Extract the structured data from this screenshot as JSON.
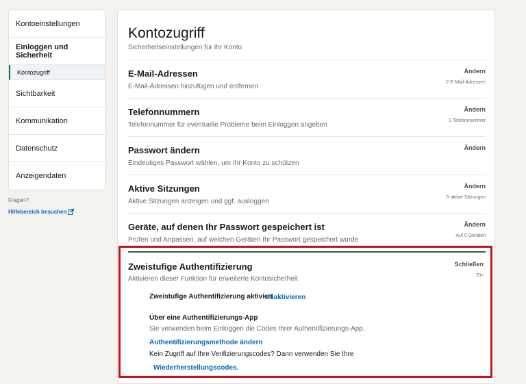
{
  "sidebar": {
    "items": [
      {
        "label": "Kontoeinstellungen"
      },
      {
        "label": "Einloggen und Sicherheit"
      },
      {
        "label": "Kontozugriff"
      },
      {
        "label": "Sichtbarkeit"
      },
      {
        "label": "Kommunikation"
      },
      {
        "label": "Datenschutz"
      },
      {
        "label": "Anzeigendaten"
      }
    ],
    "help_question": "Fragen?",
    "help_link": "Hilfebereich besuchen"
  },
  "main": {
    "title": "Kontozugriff",
    "subtitle": "Sicherheitseinstellungen für Ihr Konto",
    "sections": [
      {
        "title": "E-Mail-Adressen",
        "desc": "E-Mail-Adressen hinzufügen und entfernen",
        "action": "Ändern",
        "meta": "2 E-Mail-Adressen"
      },
      {
        "title": "Telefonnummern",
        "desc": "Telefonnummer für eventuelle Probleme beim Einloggen angeben",
        "action": "Ändern",
        "meta": "1 Telefonnummer"
      },
      {
        "title": "Passwort ändern",
        "desc": "Eindeutiges Passwort wählen, um Ihr Konto zu schützen",
        "action": "Ändern",
        "meta": ""
      },
      {
        "title": "Aktive Sitzungen",
        "desc": "Aktive Sitzungen anzeigen und ggf. ausloggen",
        "action": "Ändern",
        "meta": "5 aktive Sitzungen"
      },
      {
        "title": "Geräte, auf denen Ihr Passwort gespeichert ist",
        "desc": "Prüfen und Anpassen, auf welchen Geräten Ihr Passwort gespeichert wurde",
        "action": "Ändern",
        "meta": "Auf 0 Geräten"
      }
    ],
    "two_factor": {
      "title": "Zweistufige Authentifizierung",
      "desc": "Aktivieren dieser Funktion für erweiterte Kontosicherheit",
      "action": "Schließen",
      "state": "Ein",
      "status_text": "Zweistufige Authentifizierung aktiviert",
      "deactivate": "deaktivieren",
      "method_heading": "Über eine Authentifizierungs-App",
      "method_desc": "Sie verwenden beim Einloggen die Codes Ihrer Authentifizierungs-App.",
      "change_method": "Authentifizierungsmethode ändern",
      "no_access": "Kein Zugriff auf Ihre Verifizierungscodes? Dann verwenden Sie Ihre",
      "recovery_codes": "Wiederherstellungscodes."
    }
  },
  "colors": {
    "link": "#0a66c2",
    "highlight_border": "#c0141b",
    "active_marker": "#057642"
  }
}
